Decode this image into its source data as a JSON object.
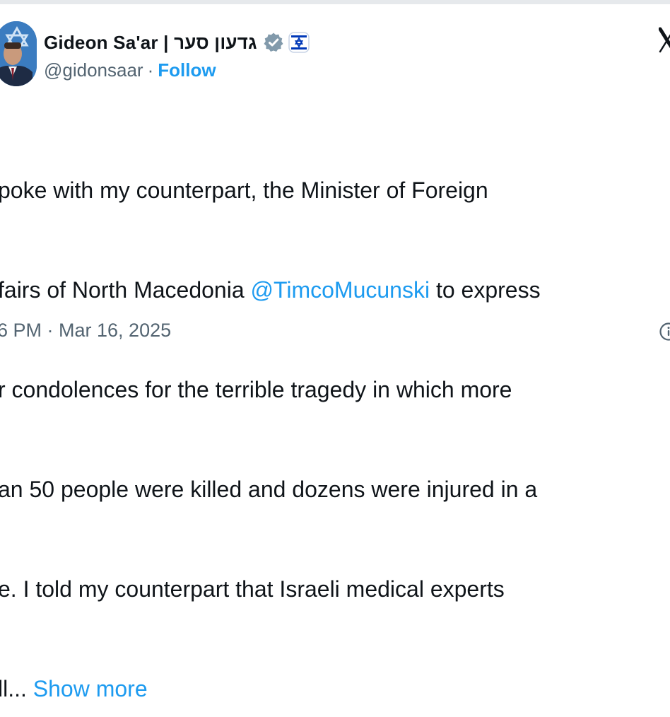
{
  "author": {
    "name": "Gideon Sa'ar | גדעון סער",
    "handle": "@gidonsaar",
    "separator": "·",
    "follow_label": "Follow"
  },
  "tweet": {
    "line1": "poke with my counterpart, the Minister of Foreign",
    "line2_pre": "fairs of North Macedonia ",
    "line2_mention": "@TimcoMucunski",
    "line2_post": " to express",
    "line3": "r condolences for the terrible tragedy in which more",
    "line4": "an 50 people were killed and dozens were injured in a",
    "line5": "e. I told my counterpart that Israeli medical experts",
    "line6_pre": "ll... ",
    "show_more": "Show more"
  },
  "meta": {
    "timestamp": "6 PM · Mar 16, 2025"
  },
  "icons": {
    "verified": "verified-badge-icon",
    "flag": "israel-flag-icon",
    "platform": "x-logo-icon",
    "info": "info-icon"
  },
  "colors": {
    "link": "#1d9bf0",
    "secondary_text": "#536471",
    "primary_text": "#0f1419",
    "verified_badge": "#829aab",
    "flag_blue": "#0038b8"
  }
}
